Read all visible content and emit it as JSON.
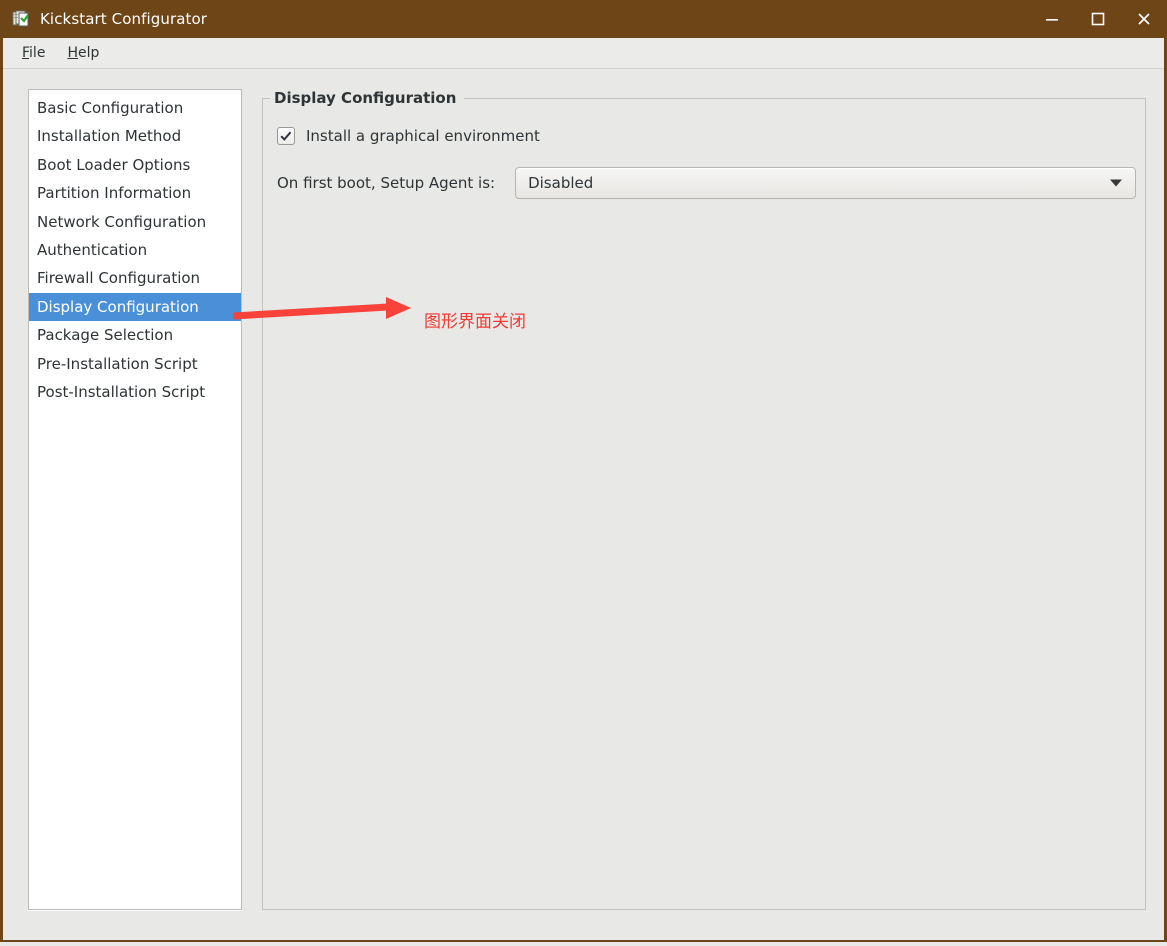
{
  "window": {
    "title": "Kickstart Configurator",
    "icon": "kickstart-app-icon",
    "titlebar_color": "#6e4516",
    "controls": {
      "minimize": "minimize-icon",
      "maximize": "maximize-icon",
      "close": "close-icon"
    }
  },
  "menubar": {
    "items": [
      {
        "label": "File",
        "mnemonic": "F",
        "rest": "ile"
      },
      {
        "label": "Help",
        "mnemonic": "H",
        "rest": "elp"
      }
    ]
  },
  "sidebar": {
    "selected_index": 7,
    "selection_color": "#4a90d9",
    "items": [
      {
        "label": "Basic Configuration"
      },
      {
        "label": "Installation Method"
      },
      {
        "label": "Boot Loader Options"
      },
      {
        "label": "Partition Information"
      },
      {
        "label": "Network Configuration"
      },
      {
        "label": "Authentication"
      },
      {
        "label": "Firewall Configuration"
      },
      {
        "label": "Display Configuration"
      },
      {
        "label": "Package Selection"
      },
      {
        "label": "Pre-Installation Script"
      },
      {
        "label": "Post-Installation Script"
      }
    ]
  },
  "main": {
    "frame_legend": "Display Configuration",
    "checkbox": {
      "label": "Install a graphical environment",
      "checked": true
    },
    "setup_agent": {
      "label": "On first boot, Setup Agent is:",
      "value": "Disabled",
      "arrow_icon": "chevron-down-icon"
    }
  },
  "annotation": {
    "text": "图形界面关闭",
    "color": "#ee3b33",
    "arrow_icon": "red-arrow-icon"
  }
}
